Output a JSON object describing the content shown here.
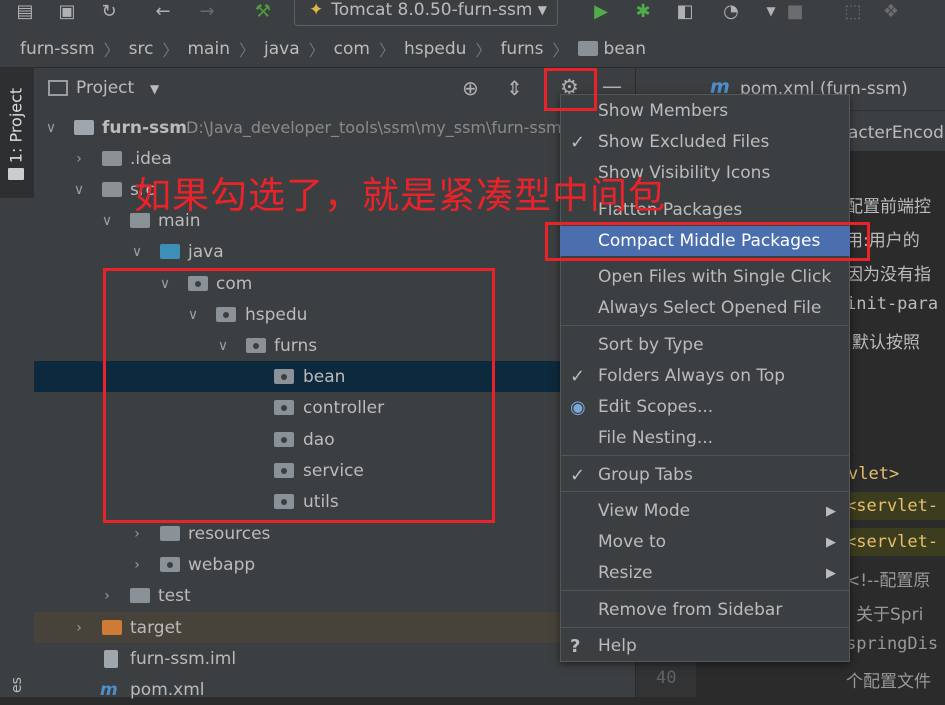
{
  "toolbar": {
    "run_config": "Tomcat 8.0.50-furn-ssm"
  },
  "breadcrumb": [
    "furn-ssm",
    "src",
    "main",
    "java",
    "com",
    "hspedu",
    "furns",
    "bean"
  ],
  "left_strip": {
    "project_tab": "1: Project",
    "bottom_tab": "es"
  },
  "project_panel": {
    "title": "Project"
  },
  "tree": {
    "root_name": "furn-ssm",
    "root_path": "D:\\Java_developer_tools\\ssm\\my_ssm\\furn-ssm",
    "idea": ".idea",
    "src": "src",
    "main": "main",
    "java": "java",
    "com": "com",
    "hspedu": "hspedu",
    "furns": "furns",
    "bean": "bean",
    "controller": "controller",
    "dao": "dao",
    "service": "service",
    "utils": "utils",
    "resources": "resources",
    "webapp": "webapp",
    "test": "test",
    "target": "target",
    "iml": "furn-ssm.iml",
    "pom": "pom.xml"
  },
  "annotation": "如果勾选了，就是紧凑型中间包",
  "editor": {
    "tab": "pom.xml (furn-ssm)",
    "tab2": "acterEncodi",
    "lines": [
      "配置前端控",
      "用:用户的",
      "因为没有指",
      "init-para",
      "默认按照",
      "vlet>",
      "<servlet-",
      "<servlet-",
      "<!--配置原",
      "关于Spri",
      "springDis",
      "个配置文件"
    ],
    "line_number": "40"
  },
  "menu": {
    "items": [
      {
        "label": "Show Members",
        "check": ""
      },
      {
        "label": "Show Excluded Files",
        "check": "✓"
      },
      {
        "label": "Show Visibility Icons",
        "check": ""
      },
      {
        "label": "Flatten Packages",
        "check": ""
      },
      {
        "label": "Compact Middle Packages",
        "check": ""
      },
      {
        "label": "Open Files with Single Click",
        "check": ""
      },
      {
        "label": "Always Select Opened File",
        "check": ""
      },
      {
        "label": "Sort by Type",
        "check": ""
      },
      {
        "label": "Folders Always on Top",
        "check": "✓"
      },
      {
        "label": "Edit Scopes...",
        "check": "◉"
      },
      {
        "label": "File Nesting...",
        "check": ""
      },
      {
        "label": "Group Tabs",
        "check": "✓"
      },
      {
        "label": "View Mode",
        "check": ""
      },
      {
        "label": "Move to",
        "check": ""
      },
      {
        "label": "Resize",
        "check": ""
      },
      {
        "label": "Remove from Sidebar",
        "check": ""
      },
      {
        "label": "Help",
        "check": "?"
      }
    ]
  }
}
